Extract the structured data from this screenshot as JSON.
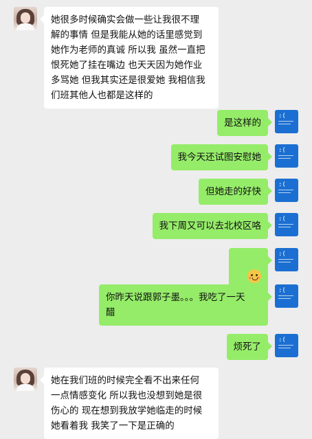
{
  "conversation": {
    "messages": [
      {
        "side": "left",
        "text": "她很多时候确实会做一些让我很不理\n解的事情 但是我能从她的话里感觉到\n她作为老师的真诚 所以我 虽然一直把\n恨死她了挂在嘴边 也天天因为她作业\n多骂她 但我其实还是很爱她 我相信我\n们班其他人也都是这样的"
      },
      {
        "side": "right",
        "text": "是这样的"
      },
      {
        "side": "right",
        "text": "我今天还试图安慰她"
      },
      {
        "side": "right",
        "text": "但她走的好快"
      },
      {
        "side": "right",
        "text": "我下周又可以去北校区咯"
      },
      {
        "side": "right",
        "emoji": "blushing-face"
      },
      {
        "side": "right",
        "text": "你昨天说跟郭子墨。。。我吃了一天\n醋"
      },
      {
        "side": "right",
        "text": "烦死了"
      },
      {
        "side": "left",
        "text": "她在我们班的时候完全看不出来任何\n一点情感变化 所以我也没想到她是很\n伤心的 现在想到我放学她临走的时候\n她看着我 我笑了一下是正确的"
      }
    ]
  },
  "avatars": {
    "contact": "girl-photo-avatar",
    "self": "blue-error-screen-avatar",
    "self_text": ":("
  },
  "colors": {
    "background": "#ededed",
    "incoming_bubble": "#ffffff",
    "outgoing_bubble": "#95ec69"
  }
}
